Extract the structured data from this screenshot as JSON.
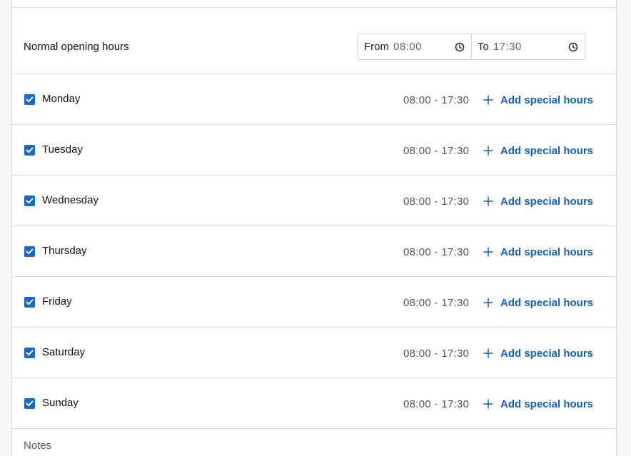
{
  "opening_hours": {
    "label": "Normal opening hours",
    "from": {
      "label": "From",
      "value": "08:00",
      "icon": "clock-icon"
    },
    "to": {
      "label": "To",
      "value": "17:30",
      "icon": "clock-icon"
    }
  },
  "days": [
    {
      "name": "Monday",
      "checked": true,
      "hours": "08:00 - 17:30",
      "action": "Add special hours"
    },
    {
      "name": "Tuesday",
      "checked": true,
      "hours": "08:00 - 17:30",
      "action": "Add special hours"
    },
    {
      "name": "Wednesday",
      "checked": true,
      "hours": "08:00 - 17:30",
      "action": "Add special hours"
    },
    {
      "name": "Thursday",
      "checked": true,
      "hours": "08:00 - 17:30",
      "action": "Add special hours"
    },
    {
      "name": "Friday",
      "checked": true,
      "hours": "08:00 - 17:30",
      "action": "Add special hours"
    },
    {
      "name": "Saturday",
      "checked": true,
      "hours": "08:00 - 17:30",
      "action": "Add special hours"
    },
    {
      "name": "Sunday",
      "checked": true,
      "hours": "08:00 - 17:30",
      "action": "Add special hours"
    }
  ],
  "notes": {
    "label": "Notes"
  },
  "colors": {
    "accent": "#1769c5",
    "link": "#1460b5",
    "border": "#dcdcdc"
  }
}
